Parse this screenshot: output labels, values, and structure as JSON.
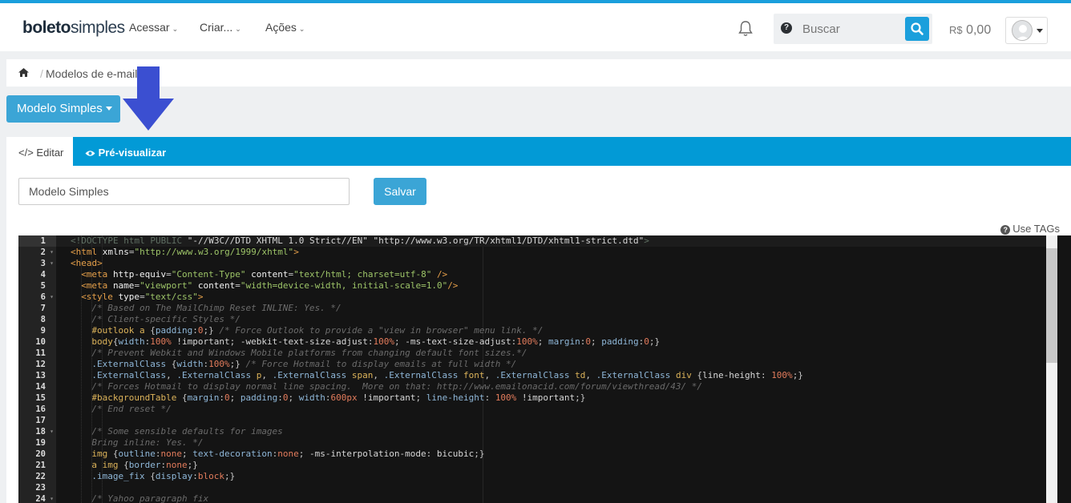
{
  "header": {
    "logo_bold": "boleto",
    "logo_rest": "simples",
    "nav": [
      {
        "label": "Acessar"
      },
      {
        "label": "Criar..."
      },
      {
        "label": "Ações"
      }
    ],
    "search_placeholder": "Buscar",
    "balance_currency": "R$",
    "balance_value": "0,00"
  },
  "breadcrumb": {
    "current": "Modelos de e-mail",
    "separator": "/"
  },
  "model_dropdown": {
    "label": "Modelo Simples"
  },
  "tabs": {
    "edit_label": "Editar",
    "preview_label": "Pré-visualizar"
  },
  "form": {
    "name_value": "Modelo Simples",
    "save_label": "Salvar",
    "use_tags_label": "Use TAGs"
  },
  "colors": {
    "brand_blue": "#1b9fdc",
    "tab_bar": "#029ad6",
    "button": "#3ba5d6",
    "annotation_arrow": "#3b4fd1"
  },
  "editor": {
    "lines": [
      {
        "n": "1",
        "fold": "",
        "indent": 0,
        "html": "<span class=\"dt\">&lt;!DOCTYPE html PUBLIC </span><span class=\"pl\">\"-//W3C//DTD XHTML 1.0 Strict//EN\" \"http://www.w3.org/TR/xhtml1/DTD/xhtml1-strict.dtd\"</span><span class=\"dt\">&gt;</span>"
      },
      {
        "n": "2",
        "fold": "▾",
        "indent": 0,
        "html": "<span class=\"tg\">&lt;html</span> <span class=\"at\">xmlns</span>=<span class=\"st\">\"http://www.w3.org/1999/xhtml\"</span><span class=\"tg\">&gt;</span>"
      },
      {
        "n": "3",
        "fold": "▾",
        "indent": 0,
        "html": "<span class=\"tg\">&lt;head&gt;</span>"
      },
      {
        "n": "4",
        "fold": "",
        "indent": 1,
        "html": "<span class=\"tg\">&lt;meta</span> <span class=\"at\">http-equiv</span>=<span class=\"st\">\"Content-Type\"</span> <span class=\"at\">content</span>=<span class=\"st\">\"text/html; charset=utf-8\"</span> <span class=\"tg\">/&gt;</span>"
      },
      {
        "n": "5",
        "fold": "",
        "indent": 1,
        "html": "<span class=\"tg\">&lt;meta</span> <span class=\"at\">name</span>=<span class=\"st\">\"viewport\"</span> <span class=\"at\">content</span>=<span class=\"st\">\"width=device-width, initial-scale=1.0\"</span><span class=\"tg\">/&gt;</span>"
      },
      {
        "n": "6",
        "fold": "▾",
        "indent": 1,
        "html": "<span class=\"tg\">&lt;style</span> <span class=\"at\">type</span>=<span class=\"st\">\"text/css\"</span><span class=\"tg\">&gt;</span>"
      },
      {
        "n": "7",
        "fold": "",
        "indent": 2,
        "html": "<span class=\"cm\">/* Based on The MailChimp Reset INLINE: Yes. */</span>"
      },
      {
        "n": "8",
        "fold": "",
        "indent": 2,
        "html": "<span class=\"cm\">/* Client-specific Styles */</span>"
      },
      {
        "n": "9",
        "fold": "",
        "indent": 2,
        "html": "<span class=\"sel\">#outlook a</span> {<span class=\"cl\">padding</span>:<span class=\"kw\">0</span>;} <span class=\"cm\">/* Force Outlook to provide a \"view in browser\" menu link. */</span>"
      },
      {
        "n": "10",
        "fold": "",
        "indent": 2,
        "html": "<span class=\"sel\">body</span>{<span class=\"cl\">width</span>:<span class=\"kw\">100%</span> <span class=\"pl\">!important</span>; <span class=\"pl\">-webkit-text-size-adjust</span>:<span class=\"kw\">100%</span>; <span class=\"pl\">-ms-text-size-adjust</span>:<span class=\"kw\">100%</span>; <span class=\"cl\">margin</span>:<span class=\"kw\">0</span>; <span class=\"cl\">padding</span>:<span class=\"kw\">0</span>;}"
      },
      {
        "n": "11",
        "fold": "",
        "indent": 2,
        "html": "<span class=\"cm\">/* Prevent Webkit and Windows Mobile platforms from changing default font sizes.*/</span>"
      },
      {
        "n": "12",
        "fold": "",
        "indent": 2,
        "html": "<span class=\"cl\">.ExternalClass</span> {<span class=\"cl\">width</span>:<span class=\"kw\">100%</span>;} <span class=\"cm\">/* Force Hotmail to display emails at full width */</span>"
      },
      {
        "n": "13",
        "fold": "",
        "indent": 2,
        "html": "<span class=\"cl\">.ExternalClass</span>, <span class=\"cl\">.ExternalClass</span> <span class=\"sel\">p</span>, <span class=\"cl\">.ExternalClass</span> <span class=\"sel\">span</span>, <span class=\"cl\">.ExternalClass</span> <span class=\"sel\">font</span>, <span class=\"cl\">.ExternalClass</span> <span class=\"sel\">td</span>, <span class=\"cl\">.ExternalClass</span> <span class=\"sel\">div</span> {<span class=\"pl\">line-height</span>: <span class=\"kw\">100%</span>;}"
      },
      {
        "n": "14",
        "fold": "",
        "indent": 2,
        "html": "<span class=\"cm\">/* Forces Hotmail to display normal line spacing.  More on that: http://www.emailonacid.com/forum/viewthread/43/ */</span>"
      },
      {
        "n": "15",
        "fold": "",
        "indent": 2,
        "html": "<span class=\"sel\">#backgroundTable</span> {<span class=\"cl\">margin</span>:<span class=\"kw\">0</span>; <span class=\"cl\">padding</span>:<span class=\"kw\">0</span>; <span class=\"cl\">width</span>:<span class=\"kw\">600px</span> <span class=\"pl\">!important</span>; <span class=\"cl\">line-height</span>: <span class=\"kw\">100%</span> <span class=\"pl\">!important</span>;}"
      },
      {
        "n": "16",
        "fold": "",
        "indent": 2,
        "html": "<span class=\"cm\">/* End reset */</span>"
      },
      {
        "n": "17",
        "fold": "",
        "indent": 0,
        "html": ""
      },
      {
        "n": "18",
        "fold": "▾",
        "indent": 2,
        "html": "<span class=\"cm\">/* Some sensible defaults for images</span>"
      },
      {
        "n": "19",
        "fold": "",
        "indent": 2,
        "html": "<span class=\"cm\">Bring inline: Yes. */</span>"
      },
      {
        "n": "20",
        "fold": "",
        "indent": 2,
        "html": "<span class=\"sel\">img</span> {<span class=\"cl\">outline</span>:<span class=\"kw\">none</span>; <span class=\"cl\">text-decoration</span>:<span class=\"kw\">none</span>; <span class=\"pl\">-ms-interpolation-mode</span>: <span class=\"pl\">bicubic</span>;}"
      },
      {
        "n": "21",
        "fold": "",
        "indent": 2,
        "html": "<span class=\"sel\">a img</span> {<span class=\"cl\">border</span>:<span class=\"kw\">none</span>;}"
      },
      {
        "n": "22",
        "fold": "",
        "indent": 2,
        "html": "<span class=\"cl\">.image_fix</span> {<span class=\"cl\">display</span>:<span class=\"kw\">block</span>;}"
      },
      {
        "n": "23",
        "fold": "",
        "indent": 0,
        "html": ""
      },
      {
        "n": "24",
        "fold": "▾",
        "indent": 2,
        "html": "<span class=\"cm\">/* Yahoo paragraph fix</span>"
      }
    ]
  }
}
